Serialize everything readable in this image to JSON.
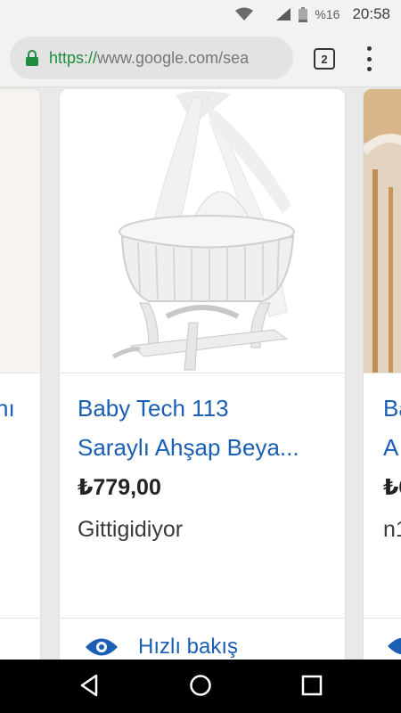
{
  "status_bar": {
    "battery_percent": "%16",
    "time": "20:58"
  },
  "browser": {
    "url_scheme": "https://",
    "url_rest": "www.google.com/sea",
    "tab_count": "2"
  },
  "cards": {
    "left": {
      "title_fragment": "nı"
    },
    "main": {
      "title_line1": "Baby Tech 113",
      "title_line2": "Saraylı Ahşap Beya...",
      "price": "₺779,00",
      "merchant": "Gittigidiyor",
      "quick_view_label": "Hızlı bakış"
    },
    "right": {
      "title_line1": "Ba",
      "title_line2": "A",
      "price": "₺6",
      "merchant": "n1"
    }
  },
  "colors": {
    "link": "#1a5fb4",
    "secure": "#1e8e3e"
  }
}
